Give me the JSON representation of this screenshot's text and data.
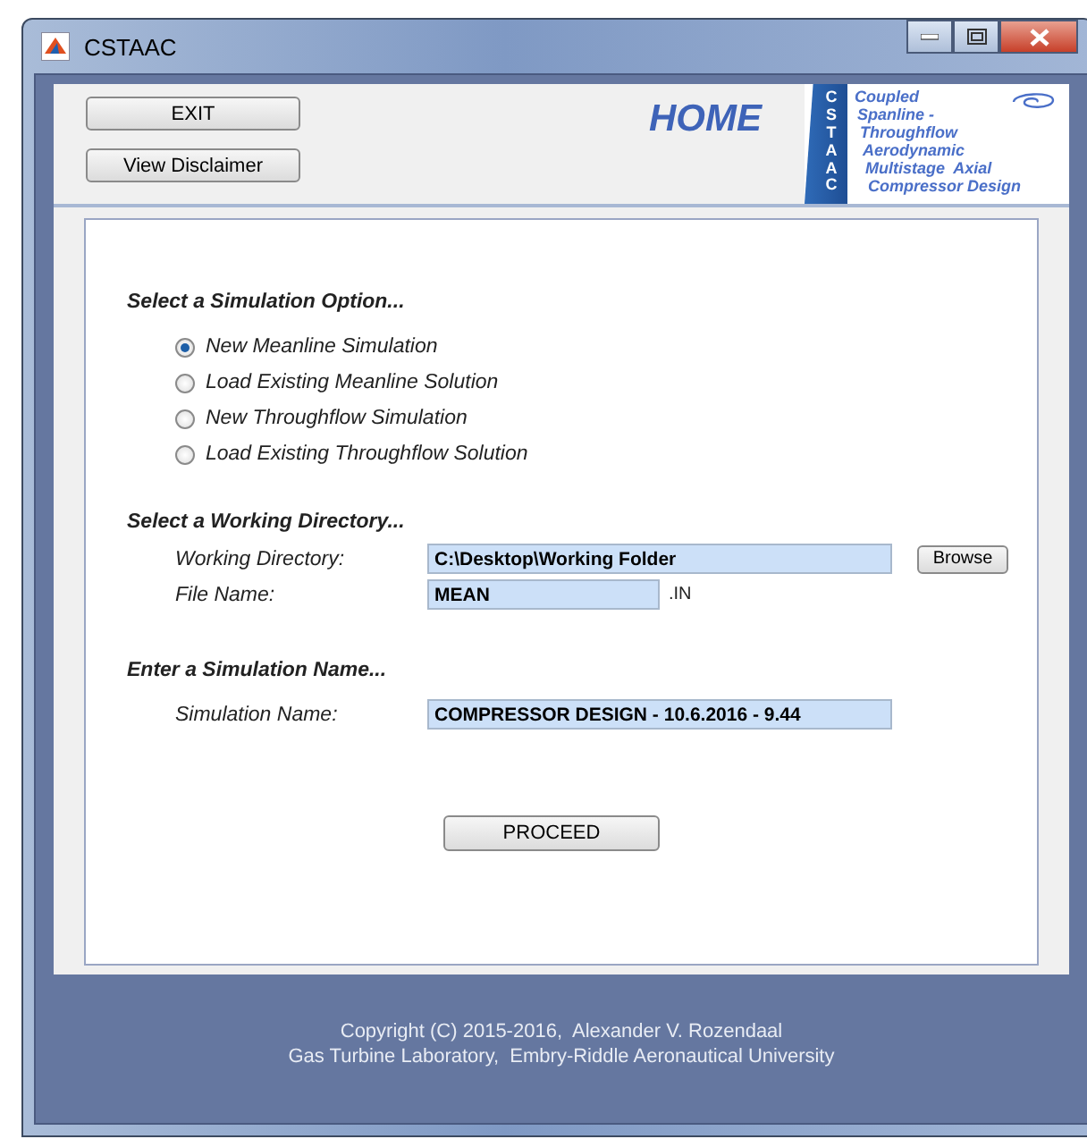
{
  "window": {
    "title": "CSTAAC"
  },
  "header": {
    "buttons": [
      "EXIT",
      "View Disclaimer"
    ],
    "title": "HOME",
    "logo": {
      "letters": "CSTAAC",
      "lines": [
        "Coupled",
        "Spanline -",
        "Throughflow",
        "Aerodynamic",
        "Multistage  Axial",
        "Compressor Design"
      ]
    }
  },
  "simulation_option": {
    "heading": "Select a Simulation Option...",
    "options": [
      {
        "label": "New Meanline Simulation",
        "selected": true
      },
      {
        "label": "Load Existing Meanline Solution",
        "selected": false
      },
      {
        "label": "New Throughflow Simulation",
        "selected": false
      },
      {
        "label": "Load Existing Throughflow Solution",
        "selected": false
      }
    ]
  },
  "working_directory": {
    "heading": "Select a Working Directory...",
    "directory_label": "Working Directory:",
    "directory_value": "C:\\Desktop\\Working Folder",
    "browse_button": "Browse",
    "file_label": "File Name:",
    "file_value": "MEAN",
    "file_extension": ".IN"
  },
  "simulation_name": {
    "heading": "Enter a Simulation Name...",
    "label": "Simulation Name:",
    "value": "COMPRESSOR DESIGN - 10.6.2016 - 9.44"
  },
  "proceed_button": "PROCEED",
  "footer": [
    "Copyright (C) 2015-2016,  Alexander V. Rozendaal",
    "Gas Turbine Laboratory,  Embry-Riddle Aeronautical University"
  ]
}
